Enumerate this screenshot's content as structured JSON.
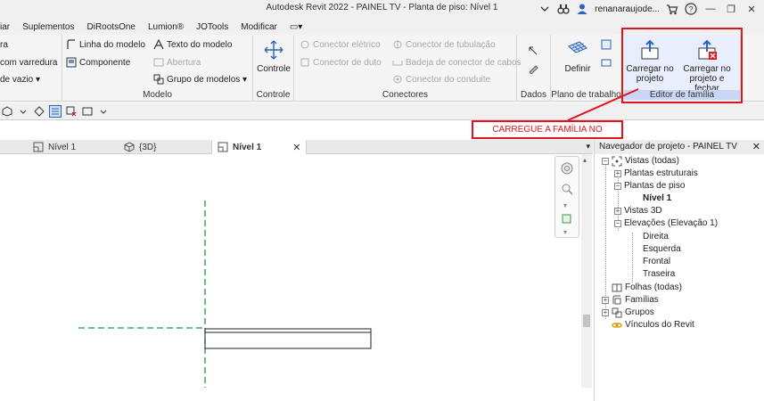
{
  "window": {
    "title": "Autodesk Revit 2022 - PAINEL TV - Planta de piso: Nível 1",
    "user": "renanaraujode...",
    "help": "?",
    "minimize": "—",
    "restore": "❐",
    "close": "✕"
  },
  "menu": {
    "items": [
      "iar",
      "Suplementos",
      "DiRootsOne",
      "Lumion®",
      "JOTools",
      "Modificar"
    ],
    "extra": "▭▾"
  },
  "ribbon": {
    "left_partial": {
      "items": [
        "ra",
        "com varredura",
        "de vazio ▾"
      ]
    },
    "modelo": {
      "label": "Modelo",
      "items": [
        "Linha do modelo",
        "Texto do modelo",
        "Componente",
        "Abertura",
        "Grupo de modelos ▾"
      ]
    },
    "controle": {
      "label": "Controle",
      "button": "Controle"
    },
    "conectores": {
      "label": "Conectores",
      "items": [
        "Conector elétrico",
        "Conector de tubulação",
        "Conector de duto",
        "Badeja de conector de cabos",
        "Conector do conduite"
      ]
    },
    "dados": {
      "label": "Dados"
    },
    "plano": {
      "label": "Plano de trabalho",
      "button": "Definir"
    },
    "familia": {
      "label": "Editor de família",
      "load": "Carregar no projeto",
      "load_close": "Carregar no projeto e fechar"
    }
  },
  "callout": {
    "text": "CARREGUE A FAMÍLIA NO PROJETO"
  },
  "view_tabs": [
    {
      "label": "Nível 1",
      "active": false
    },
    {
      "label": "{3D}",
      "active": false
    },
    {
      "label": "Nível 1",
      "active": true,
      "close": "✕"
    }
  ],
  "browser": {
    "title": "Navegador de projeto - PAINEL TV",
    "close": "✕",
    "tree": {
      "views": "Vistas (todas)",
      "structural": "Plantas estruturais",
      "floor": "Plantas de piso",
      "level1": "Nível 1",
      "views3d": "Vistas 3D",
      "elevations": "Elevações (Elevação 1)",
      "elev_items": [
        "Direita",
        "Esquerda",
        "Frontal",
        "Traseira"
      ],
      "sheets": "Folhas (todas)",
      "families": "Famílias",
      "groups": "Grupos",
      "links": "Vínculos do Revit"
    }
  },
  "colors": {
    "accent_red": "#e0141c",
    "reference_plane": "#1a9a3a",
    "family_panel": "#e8eefb"
  }
}
